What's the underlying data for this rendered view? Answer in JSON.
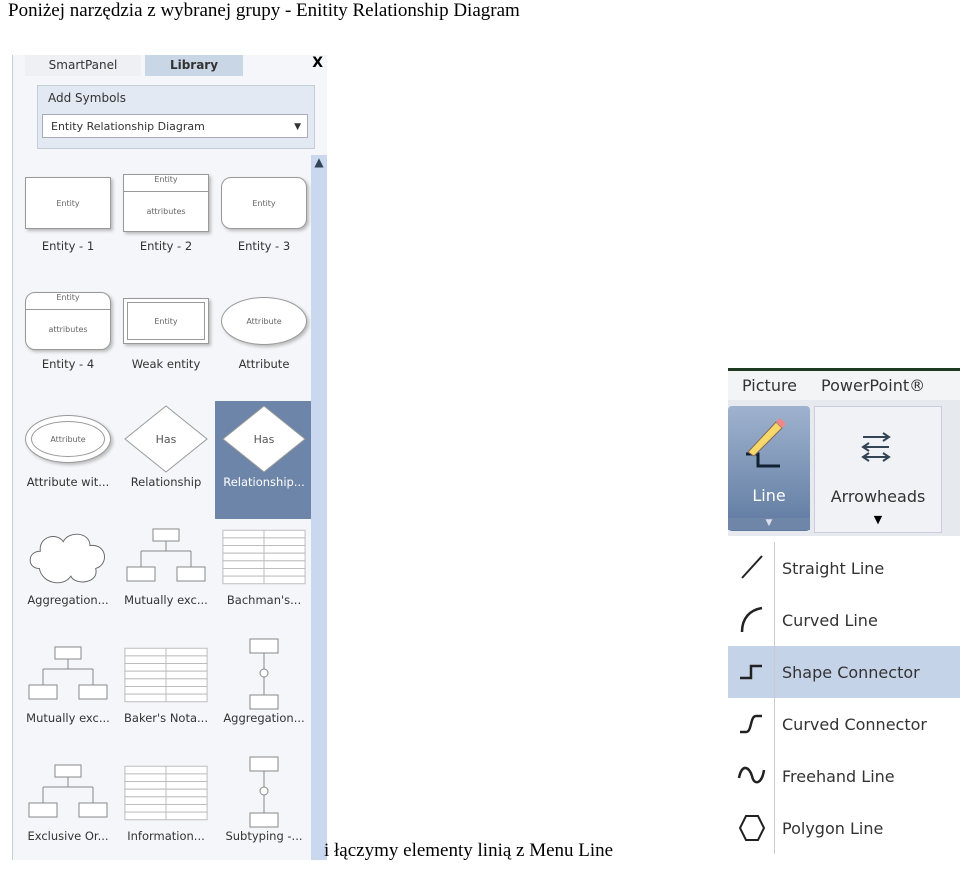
{
  "document": {
    "heading": "Poniżej narzędzia z wybranej grupy - Enitity Relationship Diagram",
    "caption": "i łączymy elementy linią z Menu Line"
  },
  "panel": {
    "tabs": [
      "SmartPanel",
      "Library"
    ],
    "close": "X",
    "add_symbols": "Add Symbols",
    "library_select": "Entity Relationship Diagram",
    "symbols": [
      {
        "label": "Entity - 1",
        "text": "Entity",
        "kind": "rect"
      },
      {
        "label": "Entity - 2",
        "text": "Entity",
        "sub": "attributes",
        "kind": "split"
      },
      {
        "label": "Entity - 3",
        "text": "Entity",
        "kind": "round"
      },
      {
        "label": "Entity - 4",
        "text": "Entity",
        "sub": "attributes",
        "kind": "split-round"
      },
      {
        "label": "Weak entity",
        "text": "Entity",
        "kind": "double"
      },
      {
        "label": "Attribute",
        "text": "Attribute",
        "kind": "ellipse"
      },
      {
        "label": "Attribute wit...",
        "text": "Attribute",
        "kind": "double-ellipse"
      },
      {
        "label": "Relationship",
        "text": "Has",
        "kind": "diamond"
      },
      {
        "label": "Relationship...",
        "text": "Has",
        "kind": "diamond",
        "selected": true
      },
      {
        "label": "Aggregation...",
        "kind": "cloud"
      },
      {
        "label": "Mutually exc...",
        "kind": "tree"
      },
      {
        "label": "Bachman's...",
        "kind": "table"
      },
      {
        "label": "Mutually exc...",
        "kind": "tree"
      },
      {
        "label": "Baker's Nota...",
        "kind": "table"
      },
      {
        "label": "Aggregation...",
        "kind": "vtree"
      },
      {
        "label": "Exclusive Or...",
        "kind": "tree"
      },
      {
        "label": "Information...",
        "kind": "table"
      },
      {
        "label": "Subtyping -...",
        "kind": "vtree"
      }
    ]
  },
  "ribbon": {
    "tabs": [
      "Picture",
      "PowerPoint®"
    ],
    "line_button": "Line",
    "arrowheads_button": "Arrowheads",
    "menu": [
      {
        "label": "Straight Line",
        "icon": "straight-line-icon"
      },
      {
        "label": "Curved Line",
        "icon": "curved-line-icon"
      },
      {
        "label": "Shape Connector",
        "icon": "shape-connector-icon",
        "highlighted": true
      },
      {
        "label": "Curved Connector",
        "icon": "curved-connector-icon"
      },
      {
        "label": "Freehand Line",
        "icon": "freehand-line-icon"
      },
      {
        "label": "Polygon Line",
        "icon": "polygon-line-icon"
      }
    ]
  }
}
